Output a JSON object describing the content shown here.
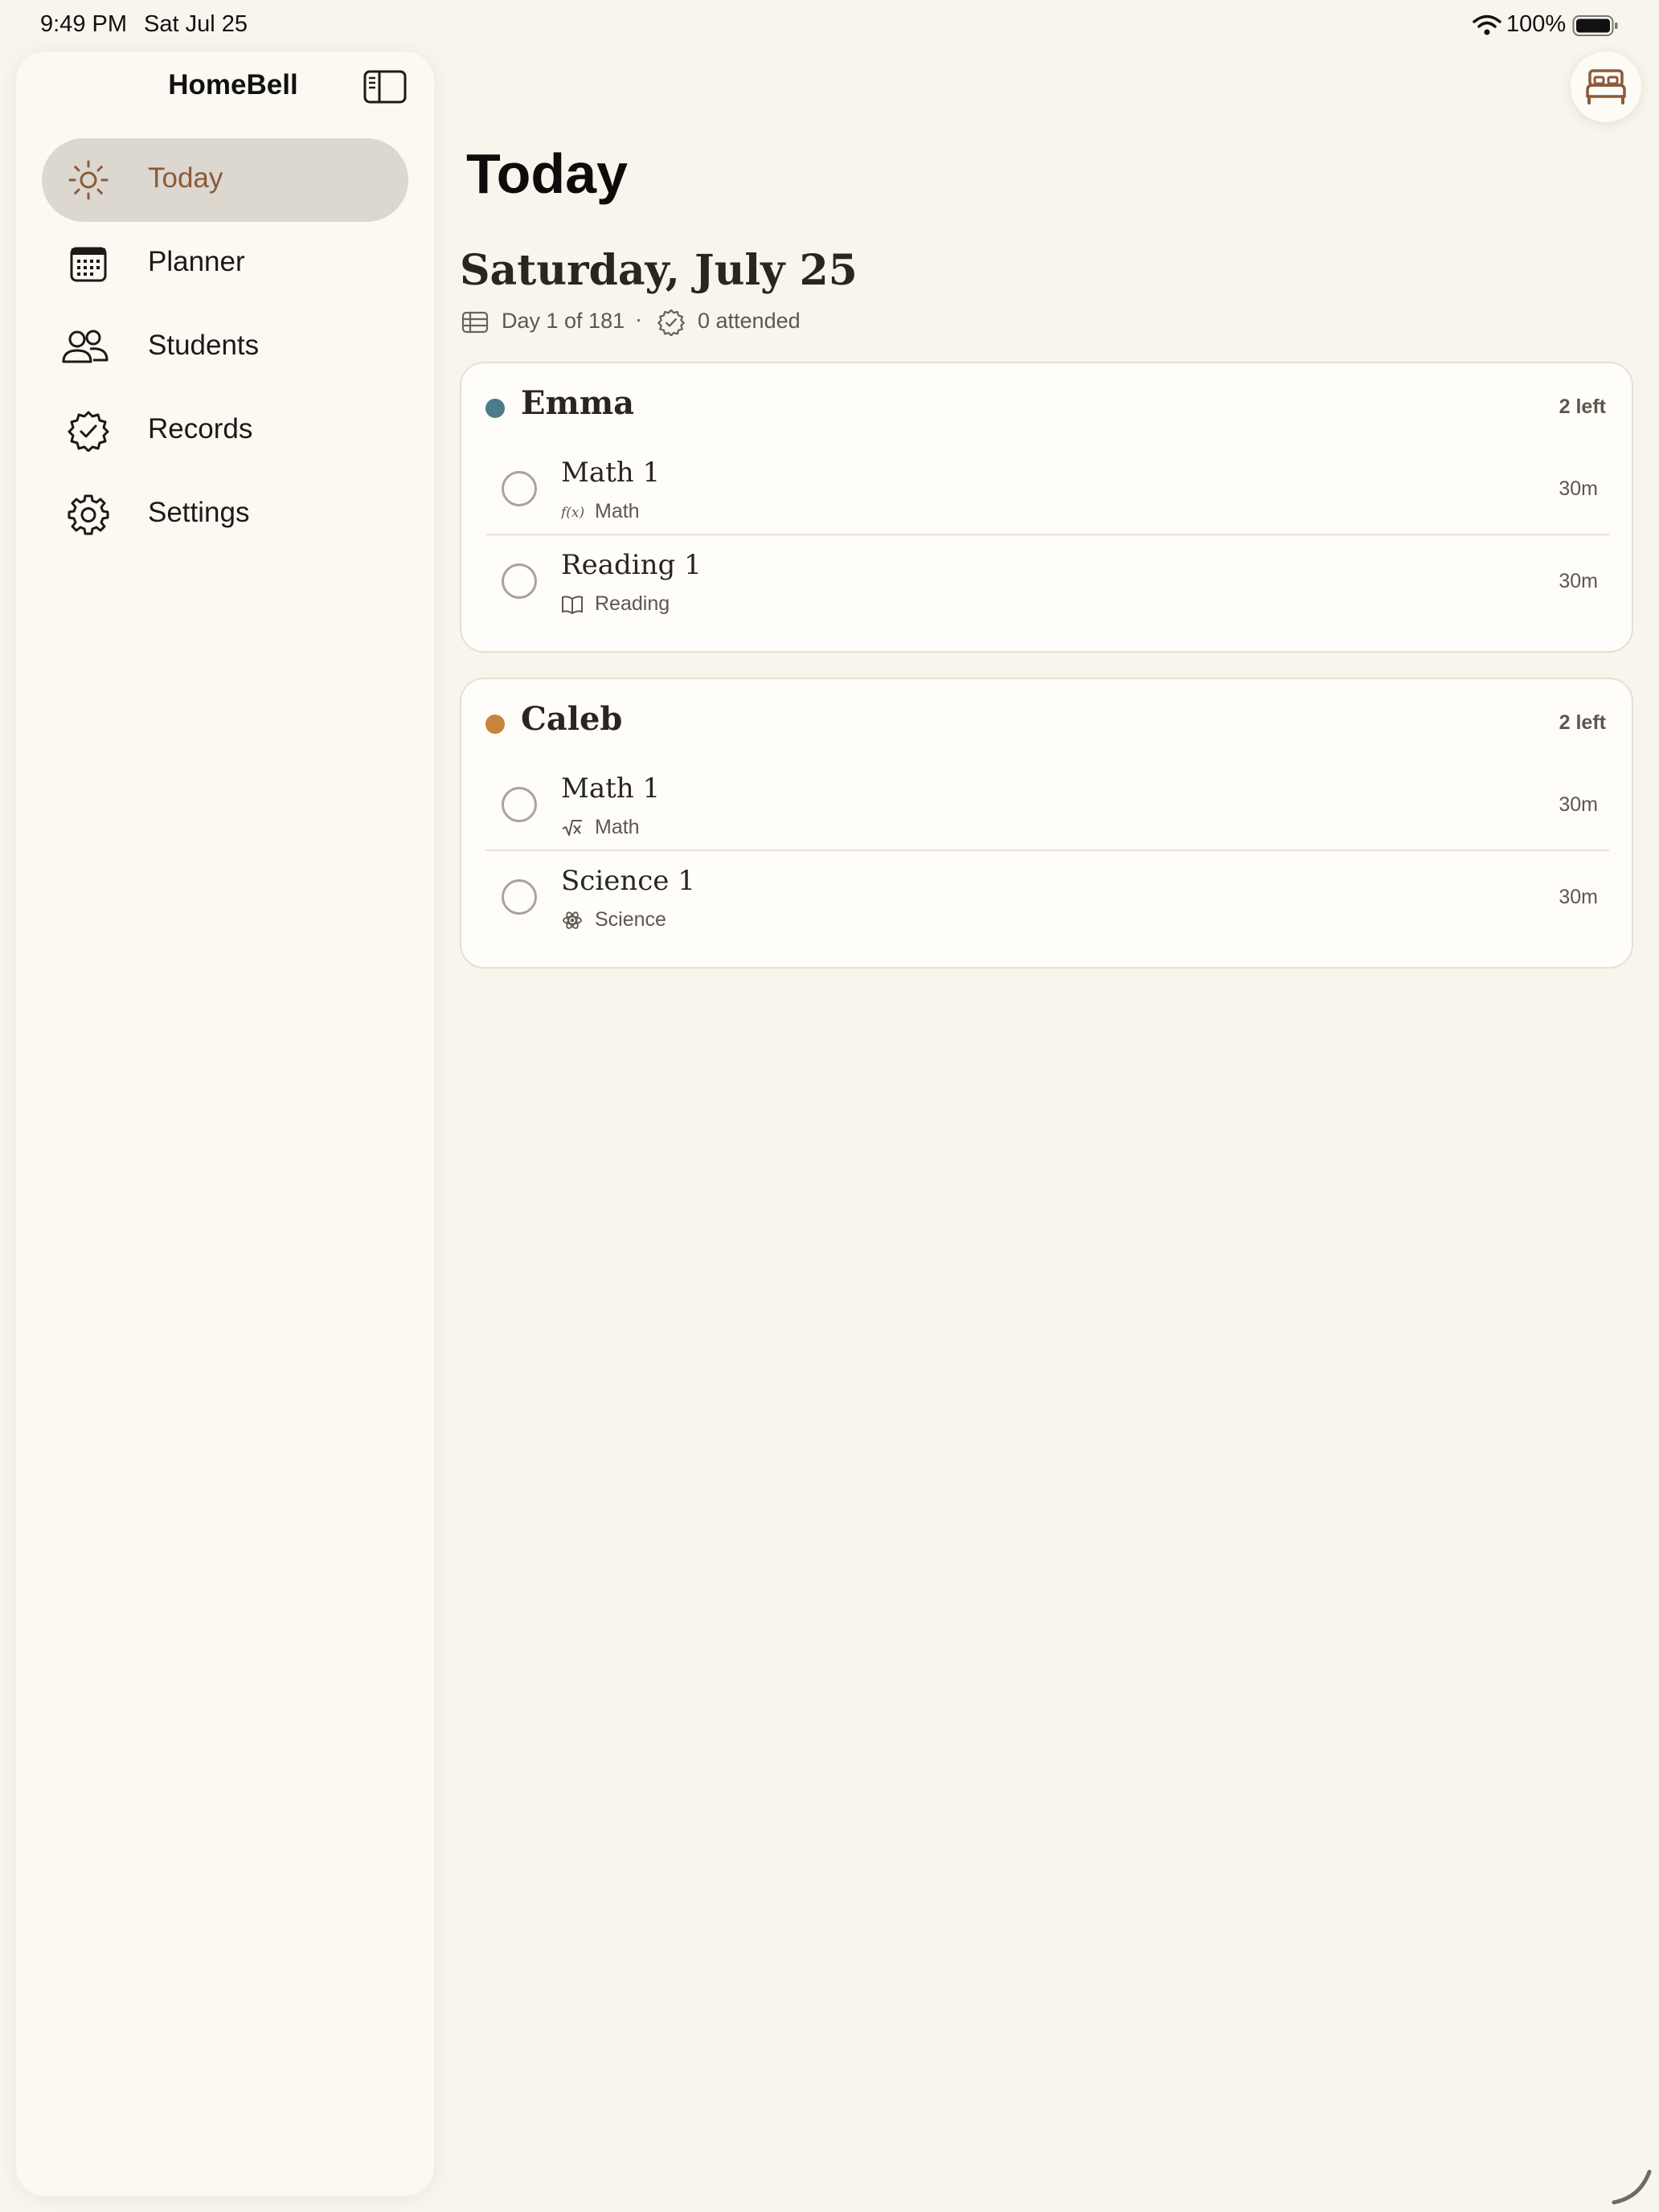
{
  "status_bar": {
    "time": "9:49 PM",
    "date": "Sat Jul 25",
    "battery": "100%"
  },
  "sidebar": {
    "title": "HomeBell",
    "items": [
      {
        "label": "Today",
        "icon": "sun-icon",
        "active": true
      },
      {
        "label": "Planner",
        "icon": "calendar-icon"
      },
      {
        "label": "Students",
        "icon": "people-icon"
      },
      {
        "label": "Records",
        "icon": "checkmark-seal-icon"
      },
      {
        "label": "Settings",
        "icon": "gear-icon"
      }
    ]
  },
  "main": {
    "title": "Today",
    "date_heading": "Saturday, July 25",
    "day_progress": "Day 1 of 181",
    "separator": "·",
    "attended": "0 attended"
  },
  "students": [
    {
      "name": "Emma",
      "color": "#4d7a8c",
      "left": "2 left",
      "lessons": [
        {
          "title": "Math 1",
          "subject": "Math",
          "icon": "function-icon",
          "duration": "30m"
        },
        {
          "title": "Reading 1",
          "subject": "Reading",
          "icon": "book-icon",
          "duration": "30m"
        }
      ]
    },
    {
      "name": "Caleb",
      "color": "#c8843a",
      "left": "2 left",
      "lessons": [
        {
          "title": "Math 1",
          "subject": "Math",
          "icon": "square-root-icon",
          "duration": "30m"
        },
        {
          "title": "Science 1",
          "subject": "Science",
          "icon": "atom-icon",
          "duration": "30m"
        }
      ]
    }
  ],
  "colors": {
    "accent": "#8b5a3a",
    "background": "#f9f5ec",
    "active_nav": "#dcd7cf"
  }
}
